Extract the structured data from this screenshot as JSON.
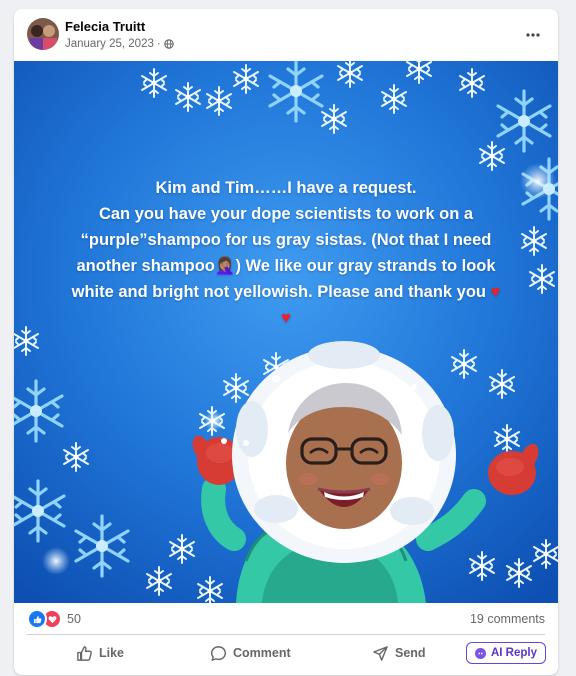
{
  "post": {
    "author": "Felecia Truitt",
    "date": "January 25, 2023",
    "separator": "·",
    "privacy_icon": "globe-icon",
    "menu_icon": "more-icon"
  },
  "content": {
    "line1": "Kim and Tim……I have a request.",
    "line2": "Can you have your dope scientists to work on a",
    "line3": "“purple”shampoo for us gray sistas. (Not that I need",
    "line4a": "another shampoo",
    "line4_emoji": "🤦🏽‍♀️",
    "line4b": ") We like our gray strands to look",
    "line5": "white and bright not yellowish. Please and thank you ",
    "heart": "♥",
    "heart2": "♥",
    "background": "#1f74d6"
  },
  "stats": {
    "reaction_count": "50",
    "comments": "19 comments",
    "reaction_icons": [
      "like-icon",
      "love-icon"
    ]
  },
  "actions": {
    "like": "Like",
    "comment": "Comment",
    "send": "Send",
    "ai_reply": "AI Reply"
  },
  "colors": {
    "accent": "#1877f2",
    "love": "#f33e58",
    "ai": "#6846d6",
    "muted": "#65676b"
  }
}
